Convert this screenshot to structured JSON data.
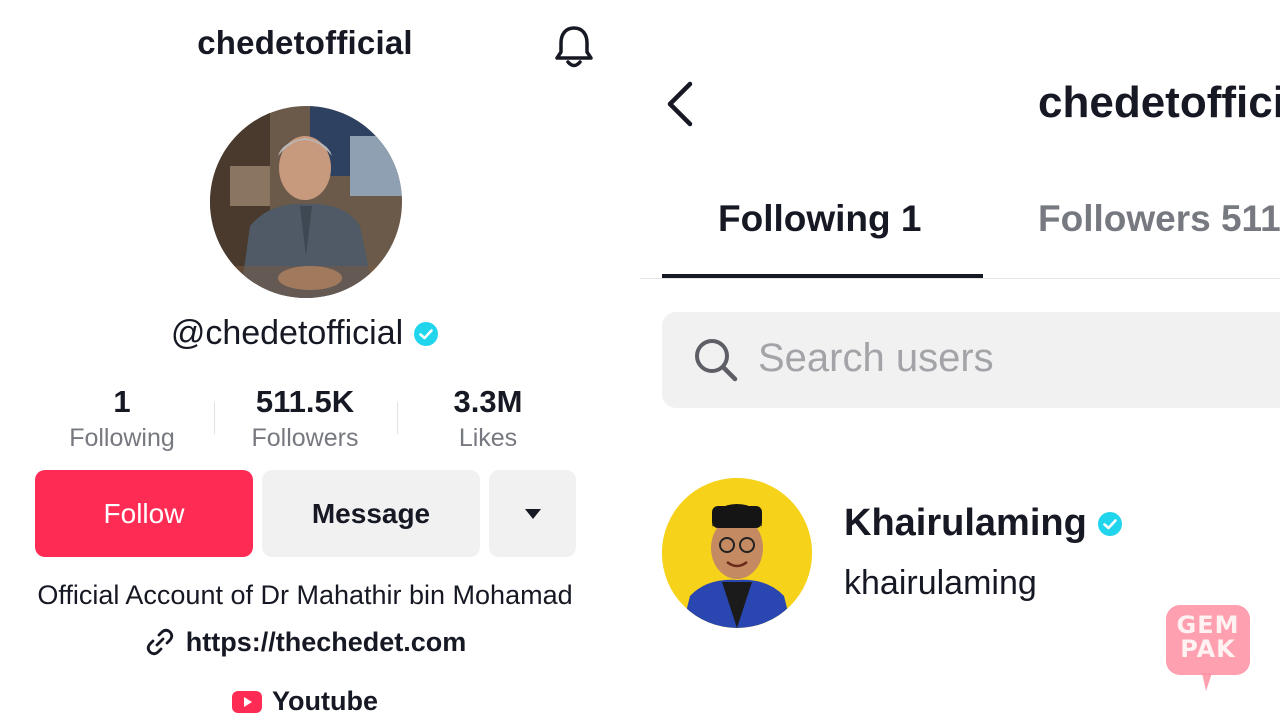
{
  "left_profile": {
    "title": "chedetofficial",
    "handle": "@chedetofficial",
    "stats": [
      {
        "value": "1",
        "label": "Following"
      },
      {
        "value": "511.5K",
        "label": "Followers"
      },
      {
        "value": "3.3M",
        "label": "Likes"
      }
    ],
    "buttons": {
      "follow": "Follow",
      "message": "Message"
    },
    "bio": "Official Account of Dr Mahathir bin Mohamad",
    "link": "https://thechedet.com",
    "youtube_label": "Youtube",
    "icons": [
      "bell-icon",
      "verified-icon",
      "caret-down-icon",
      "link-icon",
      "youtube-icon"
    ]
  },
  "right_following": {
    "title": "chedetofficial",
    "tabs": [
      {
        "label": "Following 1",
        "active": true
      },
      {
        "label": "Followers 511",
        "active": false
      }
    ],
    "search": {
      "placeholder": "Search users"
    },
    "users": [
      {
        "name": "Khairulaming",
        "handle": "khairulaming",
        "verified": true
      }
    ],
    "icons": [
      "back-chevron-icon",
      "search-icon",
      "verified-icon"
    ]
  },
  "watermark": {
    "text_line1": "GEM",
    "text_line2": "PAK"
  },
  "colors": {
    "accent": "#fe2c55",
    "verified": "#20d5ec",
    "secondary_text": "#777980",
    "button_gray": "#f1f1f2"
  }
}
